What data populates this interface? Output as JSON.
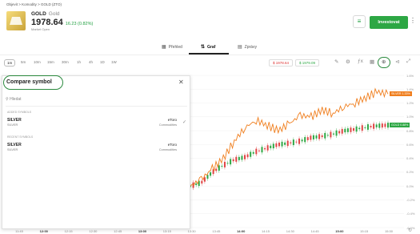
{
  "breadcrumb": "Objevit  >  Komodity  >  GOLD (ZTO)",
  "instrument": {
    "symbol": "GOLD",
    "name": "Gold",
    "price": "1978.64",
    "change": "16.23 (0.82%)",
    "market": "Market Open"
  },
  "actions": {
    "invest": "Investovat",
    "list_icon": "list-icon",
    "more_icon": "more-icon"
  },
  "tabs": [
    {
      "label": "Přehled",
      "icon": "grid-icon"
    },
    {
      "label": "Graf",
      "icon": "chart-icon"
    },
    {
      "label": "Zprávy",
      "icon": "news-icon"
    }
  ],
  "timeframes": [
    "1m",
    "5m",
    "10m",
    "15m",
    "30m",
    "1h",
    "4h",
    "1D",
    "1W"
  ],
  "prices": {
    "sell": "$ 1978.64",
    "buy": "$ 1979.09"
  },
  "compare": {
    "title": "Compare symbol",
    "search_placeholder": "Hledat",
    "added_label": "ADDED SYMBOLS",
    "recent_label": "RECENT SYMBOLS",
    "added": [
      {
        "symbol": "SILVER",
        "name": "SILVER",
        "source": "eToro",
        "category": "Commodities"
      }
    ],
    "recent": [
      {
        "symbol": "SILVER",
        "name": "SILVER",
        "source": "eToro",
        "category": "Commodities"
      }
    ]
  },
  "chart_data": {
    "type": "line",
    "y_ticks": [
      "1.6%",
      "1.4%",
      "1.2%",
      "1.0%",
      "0.8%",
      "0.6%",
      "0.4%",
      "0.2%",
      "0.0%",
      "-0.2%",
      "-0.4%",
      "-0.6%"
    ],
    "x_labels": [
      "11:45",
      "12:00",
      "12:15",
      "12:30",
      "12:45",
      "13:00",
      "13:15",
      "13:30",
      "13:45",
      "14:00",
      "14:15",
      "14:30",
      "14:45",
      "15:00",
      "15:15",
      "15:30"
    ],
    "series": [
      {
        "name": "SILVER",
        "tag": "SILVER  1.33%",
        "color": "#f07f1f",
        "values": [
          0.0,
          0.1,
          0.25,
          0.4,
          0.65,
          0.85,
          0.95,
          0.88,
          0.8,
          0.9,
          1.02,
          1.0,
          1.1,
          1.05,
          1.15,
          1.2,
          1.28,
          1.36,
          1.33
        ]
      },
      {
        "name": "GOLD",
        "tag": "GOLD  0.88%",
        "color": "#2da744",
        "values": [
          0.0,
          0.05,
          0.2,
          0.3,
          0.38,
          0.42,
          0.5,
          0.55,
          0.6,
          0.62,
          0.65,
          0.7,
          0.72,
          0.75,
          0.8,
          0.82,
          0.85,
          0.87,
          0.88
        ]
      }
    ],
    "ylim": [
      -0.6,
      1.6
    ]
  },
  "colors": {
    "green": "#2da744",
    "orange": "#f07f1f"
  }
}
